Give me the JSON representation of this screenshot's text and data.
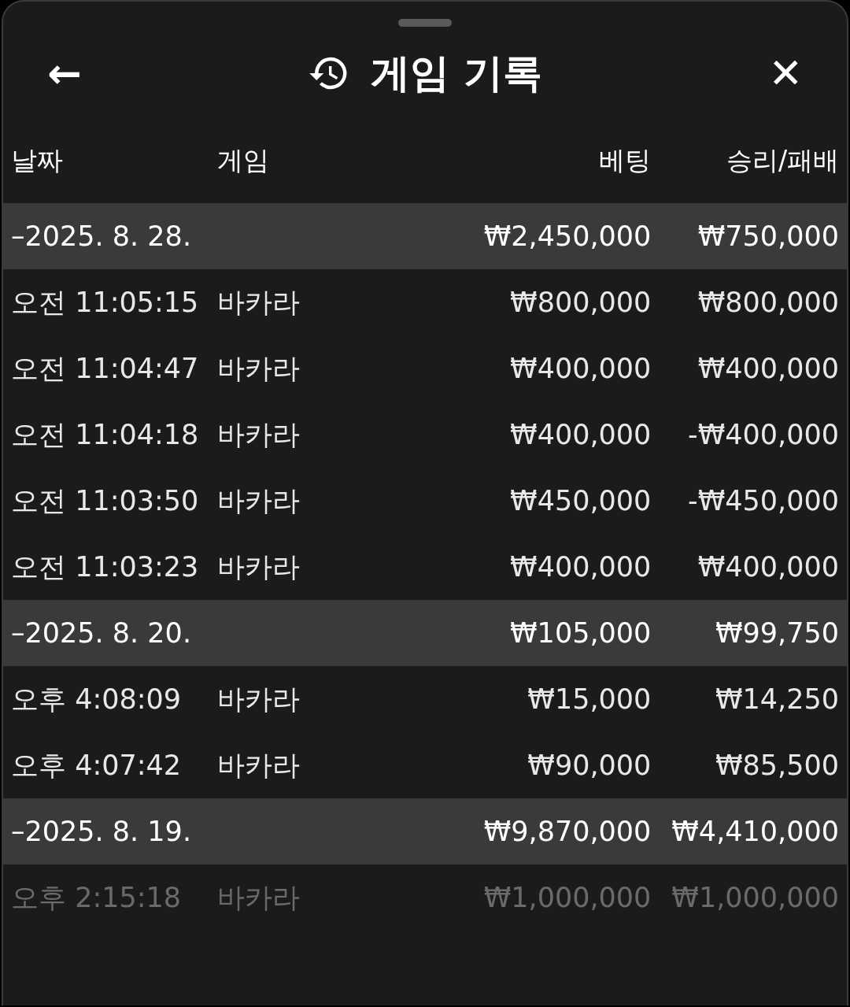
{
  "header": {
    "back": "←",
    "title": "게임 기록",
    "close": "✕"
  },
  "columns": [
    "날짜",
    "게임",
    "베팅",
    "승리/패배"
  ],
  "groups": [
    {
      "date": "–2025. 8. 28.",
      "bet": "₩2,450,000",
      "result": "₩750,000",
      "rows": [
        {
          "time": "오전 11:05:15",
          "game": "바카라",
          "bet": "₩800,000",
          "result": "₩800,000",
          "faded": false
        },
        {
          "time": "오전 11:04:47",
          "game": "바카라",
          "bet": "₩400,000",
          "result": "₩400,000",
          "faded": false
        },
        {
          "time": "오전 11:04:18",
          "game": "바카라",
          "bet": "₩400,000",
          "result": "-₩400,000",
          "faded": false
        },
        {
          "time": "오전 11:03:50",
          "game": "바카라",
          "bet": "₩450,000",
          "result": "-₩450,000",
          "faded": false
        },
        {
          "time": "오전 11:03:23",
          "game": "바카라",
          "bet": "₩400,000",
          "result": "₩400,000",
          "faded": false
        }
      ]
    },
    {
      "date": "–2025. 8. 20.",
      "bet": "₩105,000",
      "result": "₩99,750",
      "rows": [
        {
          "time": "오후 4:08:09",
          "game": "바카라",
          "bet": "₩15,000",
          "result": "₩14,250",
          "faded": false
        },
        {
          "time": "오후 4:07:42",
          "game": "바카라",
          "bet": "₩90,000",
          "result": "₩85,500",
          "faded": false
        }
      ]
    },
    {
      "date": "–2025. 8. 19.",
      "bet": "₩9,870,000",
      "result": "₩4,410,000",
      "rows": [
        {
          "time": "오후 2:15:18",
          "game": "바카라",
          "bet": "₩1,000,000",
          "result": "₩1,000,000",
          "faded": true
        }
      ]
    }
  ]
}
